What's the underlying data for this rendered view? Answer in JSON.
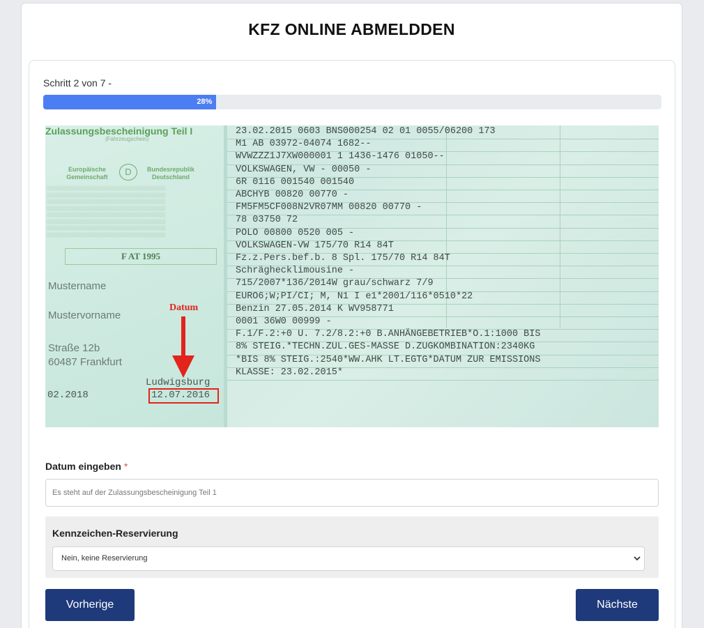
{
  "page": {
    "title": "KFZ ONLINE ABMELDDEN"
  },
  "wizard": {
    "step_text": "Schritt 2 von 7 -",
    "progress_percent": 28,
    "progress_label": "28%"
  },
  "document": {
    "title": "Zulassungsbescheinigung Teil I",
    "subtitle": "(Fahrzeugschein)",
    "eu_text": "Europäische Gemeinschaft",
    "country_code": "D",
    "country_text": "Bundesrepublik Deutschland",
    "fat_code": "F AT 1995",
    "holder_name": "Mustername",
    "holder_first_name": "Mustervorname",
    "street": "Straße 12b",
    "city": "60487 Frankfurt",
    "hu_date": "02.2018",
    "issue_place": "Ludwigsburg",
    "issue_date": "12.07.2016",
    "annotation_label": "Datum",
    "rows": [
      "23.02.2015  0603  BNS000254      02   01   0055/06200   173",
      "M1              AB               03972-04074     1682--",
      "WVWZZZ1J7XW000001         1      1436-1476       01050--",
      "VOLKSWAGEN, VW                   -          00050        -",
      "6R                               0116       001540     001540",
      "ABCHYB                           00820      00770        -",
      "FM5FM5CF008N2VR07MM              00820      00770        -",
      "                                 78         03750        72",
      "POLO                             00800      0520     005     -",
      "VOLKSWAGEN-VW                    175/70 R14 84T",
      "Fz.z.Pers.bef.b. 8 Spl.          175/70 R14 84T",
      "Schräghecklimousine              -",
      "715/2007*136/2014W               grau/schwarz         7/9",
      "EURO6;W;PI/CI; M, N1 I           e1*2001/116*0510*22",
      "Benzin                           27.05.2014      K   WV958771",
      "0001        36W0       00999     -",
      "F.1/F.2:+0 U. 7.2/8.2:+0 B.ANHÄNGEBETRIEB*O.1:1000 BIS",
      "  8% STEIG.*TECHN.ZUL.GES-MASSE D.ZUGKOMBINATION:2340KG",
      " *BIS 8% STEIG.:2540*WW.AHK LT.EGTG*DATUM ZUR EMISSIONS",
      " KLASSE: 23.02.2015*"
    ]
  },
  "form": {
    "date_label": "Datum eingeben",
    "required_mark": "*",
    "date_placeholder": "Es steht auf der Zulassungsbescheinigung Teil 1",
    "date_value": "",
    "reservation_title": "Kennzeichen-Reservierung",
    "reservation_selected": "Nein, keine Reservierung"
  },
  "nav": {
    "prev_label": "Vorherige",
    "next_label": "Nächste"
  },
  "colors": {
    "progress": "#4c7ef3",
    "button": "#1e3a7b",
    "annotation": "#e2241b"
  }
}
